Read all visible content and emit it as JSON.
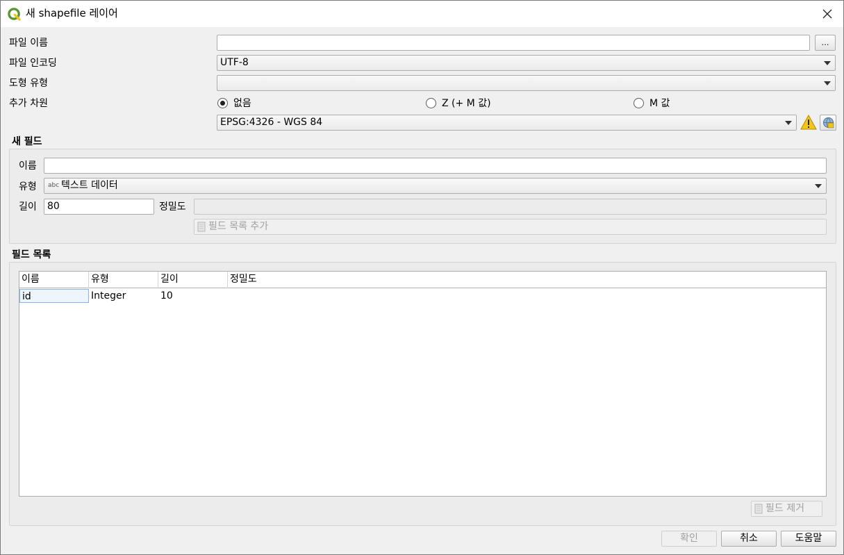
{
  "window": {
    "title": "새 shapefile 레이어"
  },
  "form": {
    "file_name_label": "파일 이름",
    "file_name_value": "",
    "browse_label": "…",
    "encoding_label": "파일 인코딩",
    "encoding_value": "UTF-8",
    "geometry_label": "도형 유형",
    "geometry_value": "",
    "dimension_label": "추가 차원",
    "dimension_options": [
      "없음",
      "Z (+ M 값)",
      "M 값"
    ],
    "dimension_selected": "없음",
    "crs_value": "EPSG:4326 - WGS 84"
  },
  "new_field": {
    "title": "새 필드",
    "name_label": "이름",
    "name_value": "",
    "type_label": "유형",
    "type_badge": "abc",
    "type_value": "텍스트 데이터",
    "length_label": "길이",
    "length_value": "80",
    "precision_label": "정밀도",
    "precision_value": "",
    "add_button": "필드 목록 추가"
  },
  "field_list": {
    "title": "필드 목록",
    "columns": [
      "이름",
      "유형",
      "길이",
      "정밀도"
    ],
    "rows": [
      [
        "id",
        "Integer",
        "10",
        ""
      ]
    ],
    "remove_button": "필드 제거"
  },
  "buttons": {
    "ok": "확인",
    "cancel": "취소",
    "help": "도움말"
  },
  "colors": {
    "qgis_green": "#589632",
    "qgis_yellow": "#f0c420",
    "warning_yellow": "#f5c518"
  }
}
